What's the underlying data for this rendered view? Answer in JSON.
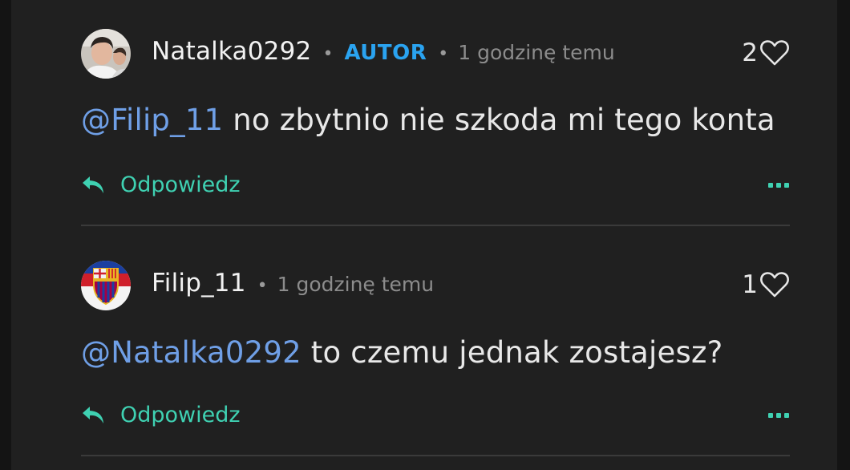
{
  "comments": [
    {
      "username": "Natalka0292",
      "badge": "AUTOR",
      "separator": "•",
      "time": "1 godzinę temu",
      "likes": "2",
      "mention": "@Filip_11",
      "text": " no zbytnio nie szkoda mi tego konta",
      "reply_label": "Odpowiedz",
      "avatar_icon": "user-photo-avatar",
      "like_icon": "heart-icon",
      "reply_icon": "reply-arrow-icon",
      "more_icon": "more-dots-icon"
    },
    {
      "username": "Filip_11",
      "separator": "•",
      "time": "1 godzinę temu",
      "likes": "1",
      "mention": "@Natalka0292",
      "text": " to czemu jednak zostajesz?",
      "reply_label": "Odpowiedz",
      "avatar_icon": "club-crest-avatar",
      "like_icon": "heart-icon",
      "reply_icon": "reply-arrow-icon",
      "more_icon": "more-dots-icon"
    }
  ],
  "colors": {
    "background": "#202020",
    "mention": "#6f9fe6",
    "badge": "#2aa3f0",
    "reply": "#3fd1b2",
    "muted": "#8c8c8c"
  }
}
